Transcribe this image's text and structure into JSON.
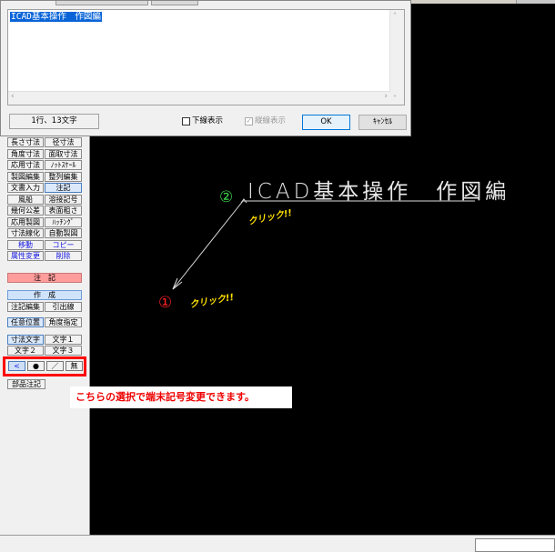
{
  "dialog": {
    "text_content": "ICAD基本操作　作図編",
    "status": "1行、13文字",
    "checkbox_underline": "下線表示",
    "checkbox_vertical": "縦線表示",
    "ok_label": "OK",
    "cancel_label": "ｷｬﾝｾﾙ"
  },
  "panel": {
    "rows": [
      [
        "長さ寸法",
        "径寸法"
      ],
      [
        "角度寸法",
        "面取寸法"
      ],
      [
        "応用寸法",
        "ﾉｯﾄｽｹｰﾙ"
      ],
      [
        "製図編集",
        "整列編集"
      ],
      [
        "文書入力",
        "注記"
      ],
      [
        "風船",
        "溶接記号"
      ],
      [
        "幾何公差",
        "表面粗さ"
      ],
      [
        "応用製図",
        "ﾊｯﾁﾝｸﾞ"
      ],
      [
        "寸法線化",
        "自動製図"
      ],
      [
        "移動",
        "コピー"
      ],
      [
        "属性変更",
        "削除"
      ]
    ],
    "section_title": "注　記",
    "create_label": "作　成",
    "note_edit": "注記編集",
    "leader": "引出線",
    "any_position": "任意位置",
    "angle_spec": "角度指定",
    "dim_text": "寸法文字",
    "text1": "文字１",
    "text2": "文字２",
    "text3": "文字３",
    "terminal_buttons": [
      "<",
      "●",
      "／",
      "無"
    ],
    "parts_note": "部品注記"
  },
  "callout": "こちらの選択で端末記号変更できます。",
  "drawing": {
    "title": "ICAD基本操作　作図編",
    "mark_2": "②",
    "mark_1": "①",
    "click_text": "クリック!!"
  }
}
